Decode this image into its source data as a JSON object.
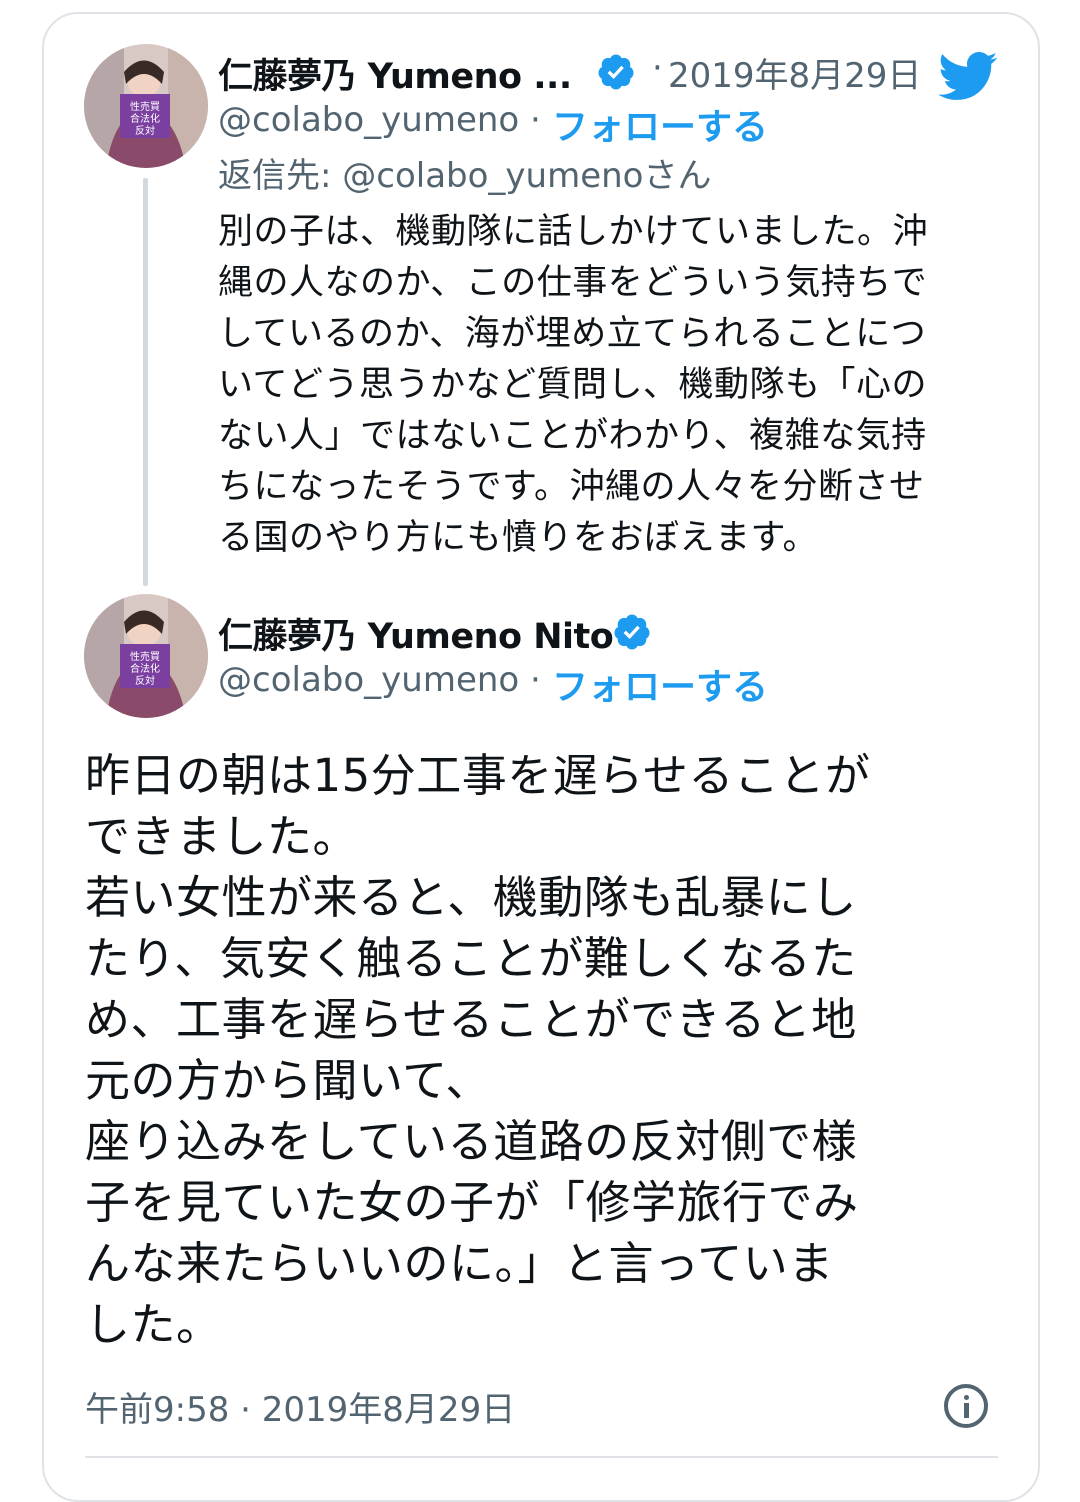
{
  "reply_tweet": {
    "display_name": "仁藤夢乃 Yumeno ...",
    "handle": "@colabo_yumeno",
    "date": "2019年8月29日",
    "follow_label": "フォローする",
    "separator": "·",
    "reply_to": "返信先: @colabo_yumenoさん",
    "avatar_sign_lines": [
      "性売買",
      "合法化",
      "反対"
    ],
    "lines": [
      "別の子は、機動隊に話しかけていました。沖",
      "縄の人なのか、この仕事をどういう気持ちで",
      "しているのか、海が埋め立てられることにつ",
      "いてどう思うかなど質問し、機動隊も「心の",
      "ない人」ではないことがわかり、複雑な気持",
      "ちになったそうです。沖縄の人々を分断させ",
      "る国のやり方にも憤りをおぼえます。"
    ]
  },
  "main_tweet": {
    "display_name": "仁藤夢乃 Yumeno Nito",
    "handle": "@colabo_yumeno",
    "follow_label": "フォローする",
    "separator": "·",
    "avatar_sign_lines": [
      "性売買",
      "合法化",
      "反対"
    ],
    "lines": [
      "昨日の朝は15分工事を遅らせることが",
      "できました。",
      "若い女性が来ると、機動隊も乱暴にし",
      "たり、気安く触ることが難しくなるた",
      "め、工事を遅らせることができると地",
      "元の方から聞いて、",
      "座り込みをしている道路の反対側で様",
      "子を見ていた女の子が「修学旅行でみ",
      "んな来たらいいのに。」と言っていま",
      "した。"
    ],
    "timestamp": "午前9:58 · 2019年8月29日"
  },
  "colors": {
    "accent": "#1d9bf0",
    "secondary_text": "#536471",
    "primary_text": "#0f1419",
    "border": "#dfe3e7",
    "sign_purple": "#7b3fa0"
  },
  "icons": [
    "verified-badge-icon",
    "twitter-bird-icon",
    "info-icon"
  ]
}
